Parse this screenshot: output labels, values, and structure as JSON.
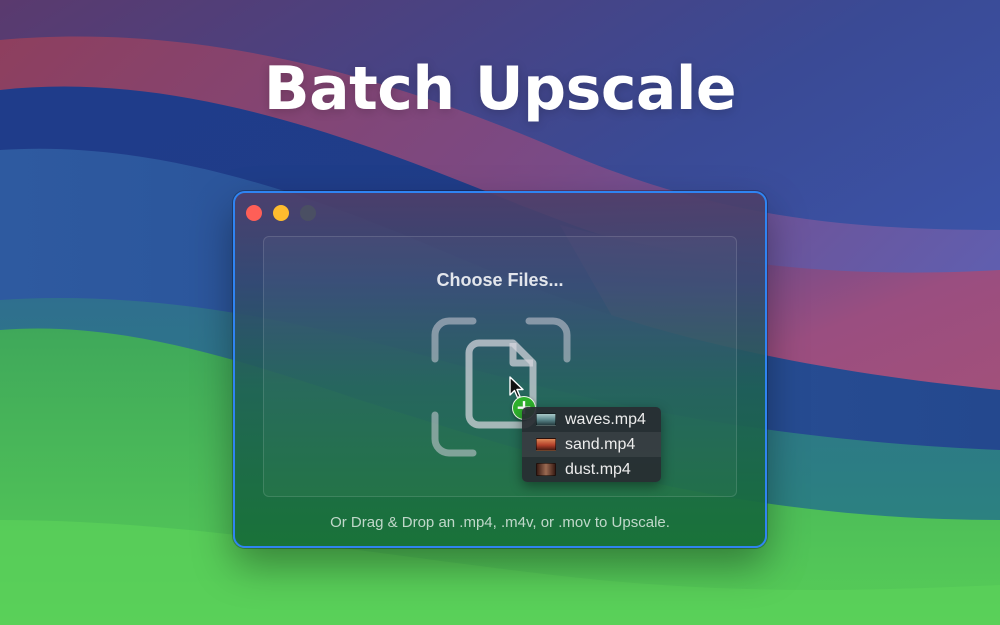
{
  "headline": "Batch Upscale",
  "window": {
    "buttons": {
      "close": "close-icon",
      "minimize": "minimize-icon",
      "zoom": "zoom-icon"
    },
    "accent_border": "#2f84f2"
  },
  "drop_zone": {
    "title": "Choose Files...",
    "icon": "document-drop-icon",
    "hint": "Or Drag & Drop an .mp4, .m4v, or .mov to Upscale."
  },
  "drag_files": [
    {
      "name": "waves.mp4",
      "thumb_colors": [
        "#7fb3b8",
        "#2c4a52"
      ]
    },
    {
      "name": "sand.mp4",
      "thumb_colors": [
        "#d46a4a",
        "#6a2418"
      ]
    },
    {
      "name": "dust.mp4",
      "thumb_colors": [
        "#9a6a52",
        "#3a1c14"
      ]
    }
  ],
  "colors": {
    "add_badge": "#2fb12c",
    "traffic_close": "#fe5f57",
    "traffic_minimize": "#febc2e"
  }
}
